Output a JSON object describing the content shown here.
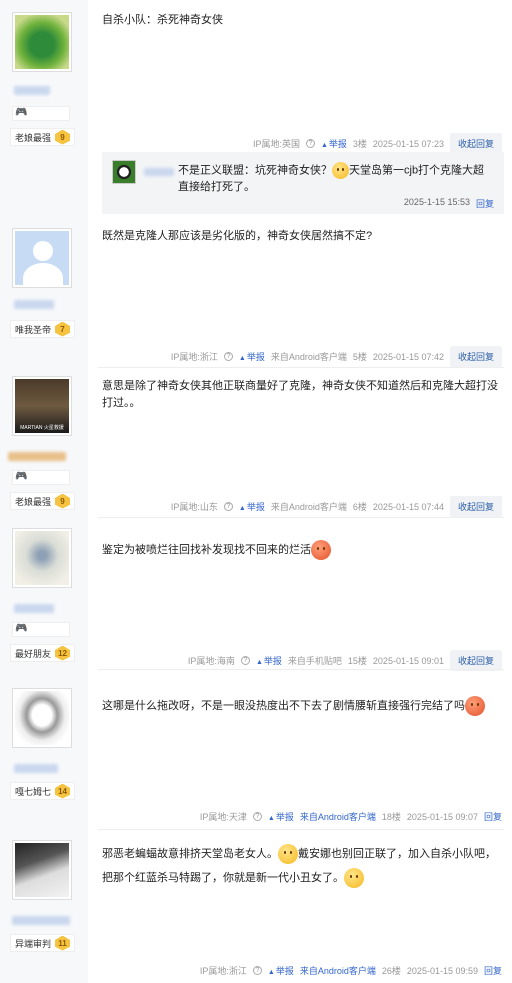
{
  "posts": [
    {
      "user": {
        "level_name": "老娘最强",
        "level": "9",
        "has_game_icon": true
      },
      "content": "自杀小队：杀死神奇女侠",
      "meta": {
        "ip": "IP属地:英国",
        "report": "举报",
        "floor": "3楼",
        "time": "2025-01-15 07:23",
        "reply": "收起回复"
      },
      "subreply": {
        "text_a": "不是正义联盟：坑死神奇女侠？",
        "text_b": "天堂岛第一cjb打个克隆大超直接给打死了。",
        "time": "2025-1-15 15:53",
        "reply": "回复"
      }
    },
    {
      "user": {
        "level_name": "唯我圣帝",
        "level": "7",
        "has_game_icon": false
      },
      "content": "既然是克隆人那应该是劣化版的，神奇女侠居然搞不定?",
      "meta": {
        "ip": "IP属地:浙江",
        "report": "举报",
        "client": "来自Android客户端",
        "floor": "5楼",
        "time": "2025-01-15 07:42",
        "reply": "收起回复"
      }
    },
    {
      "user": {
        "level_name": "老娘最强",
        "level": "9",
        "has_game_icon": true,
        "avatar_caption": "MARTIAN 火星救援"
      },
      "content": "意思是除了神奇女侠其他正联商量好了克隆，神奇女侠不知道然后和克隆大超打没打过。。",
      "meta": {
        "ip": "IP属地:山东",
        "report": "举报",
        "client": "来自Android客户端",
        "floor": "6楼",
        "time": "2025-01-15 07:44",
        "reply": "收起回复"
      }
    },
    {
      "user": {
        "level_name": "最好朋友",
        "level": "12",
        "has_game_icon": true
      },
      "content": "鉴定为被喷烂往回找补发现找不回来的烂活",
      "meta": {
        "ip": "IP属地:海南",
        "report": "举报",
        "client": "来自手机贴吧",
        "floor": "15楼",
        "time": "2025-01-15 09:01",
        "reply": "收起回复"
      }
    },
    {
      "user": {
        "level_name": "嘎七姆七",
        "level": "14",
        "has_game_icon": false
      },
      "content": "这哪是什么拖改呀，不是一眼没热度出不下去了剧情腰斩直接强行完结了吗",
      "meta": {
        "ip": "IP属地:天津",
        "report": "举报",
        "client": "来自Android客户端",
        "floor": "18楼",
        "time": "2025-01-15 09:07",
        "reply": "回复"
      }
    },
    {
      "user": {
        "level_name": "异端审判",
        "level": "11",
        "has_game_icon": false
      },
      "content_a": "邪恶老蝙蝠故意排挤天堂岛老女人。",
      "content_b": "戴安娜也别回正联了，加入自杀小队吧，把那个红蓝杀马特踢了，你就是新一代小丑女了。",
      "meta": {
        "ip": "IP属地:浙江",
        "report": "举报",
        "client": "来自Android客户端",
        "floor": "26楼",
        "time": "2025-01-15 09:59",
        "reply": "回复"
      }
    }
  ],
  "colors": {
    "link": "#3366cc",
    "sidebar_bg": "#f7f8fa",
    "badge": "#f6c341",
    "subreply_bg": "#f3f4f6"
  }
}
